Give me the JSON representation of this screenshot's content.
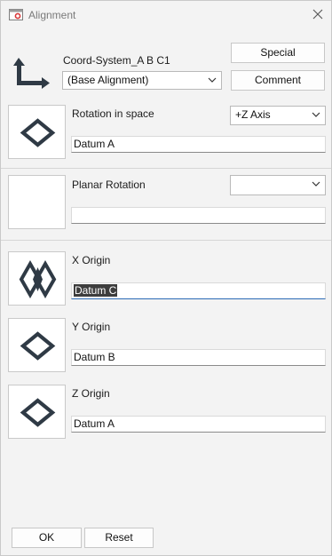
{
  "window": {
    "title": "Alignment"
  },
  "header": {
    "coord_system_label": "Coord-System_A B C1",
    "alignment_select": "(Base Alignment)",
    "special_label": "Special",
    "comment_label": "Comment"
  },
  "rotation_in_space": {
    "label": "Rotation in space",
    "axis_select": "+Z Axis",
    "datum_value": "Datum A",
    "icon": "diamond-datum-icon"
  },
  "planar_rotation": {
    "label": "Planar Rotation",
    "axis_select": "",
    "datum_value": ""
  },
  "x_origin": {
    "label": "X Origin",
    "datum_value": "Datum C",
    "icon": "double-diamond-datum-icon"
  },
  "y_origin": {
    "label": "Y Origin",
    "datum_value": "Datum B",
    "icon": "diamond-datum-icon"
  },
  "z_origin": {
    "label": "Z Origin",
    "datum_value": "Datum A",
    "icon": "diamond-datum-icon"
  },
  "footer": {
    "ok_label": "OK",
    "reset_label": "Reset"
  },
  "colors": {
    "icon_dark": "#2f3a45",
    "app_icon_red": "#d9383a",
    "focus_underline": "#2b6ab5"
  }
}
